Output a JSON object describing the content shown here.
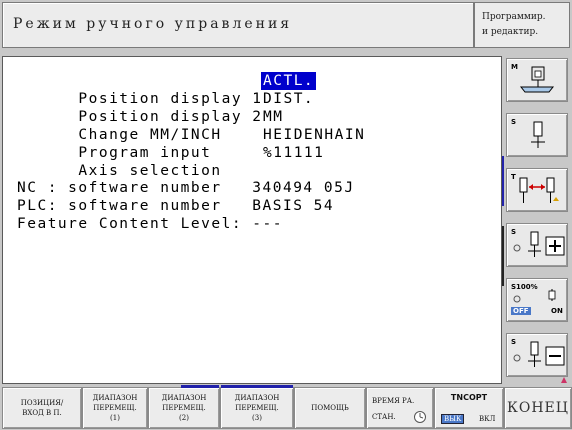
{
  "header": {
    "mode_title": "Режим ручного управления",
    "mode_line1": "Программир.",
    "mode_line2": "и редактир."
  },
  "main": {
    "settings": [
      {
        "key": "Position display 1",
        "value": "ACTL.",
        "highlight": true
      },
      {
        "key": "Position display 2",
        "value": "DIST.",
        "highlight": false
      },
      {
        "key": "Change MM/INCH",
        "value": "MM",
        "highlight": false
      },
      {
        "key": "Program input",
        "value": "HEIDENHAIN",
        "highlight": false
      },
      {
        "key": "Axis selection",
        "value": "%11111",
        "highlight": false
      }
    ],
    "nc_line": "NC : software number   340494 05J",
    "plc_line": "PLC: software number   BASIS 54",
    "feature_line": "Feature Content Level: ---"
  },
  "sidebar": {
    "m_label": "M",
    "s_label": "S",
    "t_label": "T",
    "s_plus_label": "S",
    "s100_label": "S100%",
    "off_label": "OFF",
    "on_label": "ON",
    "s_minus_label": "S"
  },
  "softkeys": {
    "k1_l1": "ПОЗИЦИЯ/",
    "k1_l2": "ВХОД В П.",
    "k2_l1": "ДИАПАЗОН",
    "k2_l2": "ПЕРЕМЕЩ.",
    "k2_l3": "(1)",
    "k3_l1": "ДИАПАЗОН",
    "k3_l2": "ПЕРЕМЕЩ.",
    "k3_l3": "(2)",
    "k4_l1": "ДИАПАЗОН",
    "k4_l2": "ПЕРЕМЕЩ.",
    "k4_l3": "(3)",
    "k5_l1": "ПОМОЩЬ",
    "k6_l1": "ВРЕМЯ РА.",
    "k6_l2": "СТАН.",
    "k7_l1": "TNCOPT",
    "k7_off": "ВЫК",
    "k7_on": "ВКЛ",
    "k8_l1": "КОНЕЦ"
  },
  "colors": {
    "highlight": "#0000cc",
    "active_tab": "#2222aa"
  }
}
